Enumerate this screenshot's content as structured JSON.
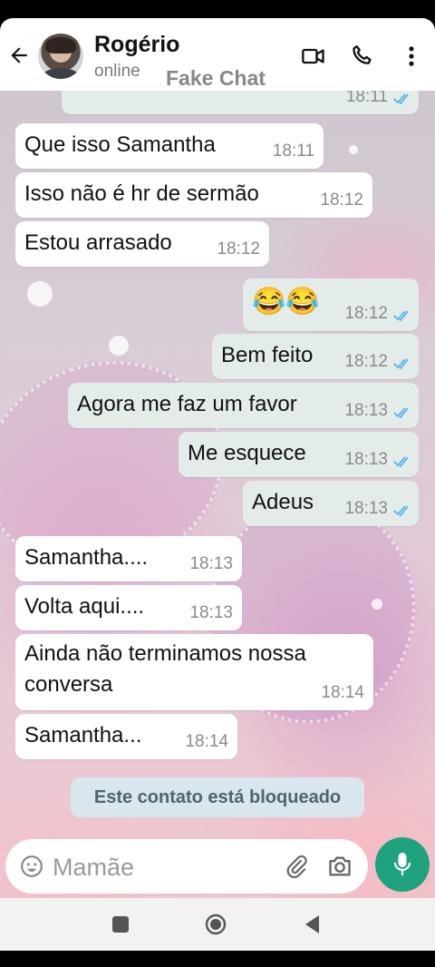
{
  "header": {
    "contact_name": "Rogério",
    "status": "online",
    "watermark": "Fake Chat"
  },
  "messages": [
    {
      "dir": "out",
      "text": "",
      "time": "18:11",
      "read": true
    },
    {
      "dir": "in",
      "text": "Que isso Samantha",
      "time": "18:11"
    },
    {
      "dir": "in",
      "text": "Isso não é hr de sermão",
      "time": "18:12"
    },
    {
      "dir": "in",
      "text": "Estou arrasado",
      "time": "18:12"
    },
    {
      "dir": "out",
      "text": "😂😂",
      "time": "18:12",
      "read": true
    },
    {
      "dir": "out",
      "text": "Bem feito",
      "time": "18:12",
      "read": true
    },
    {
      "dir": "out",
      "text": "Agora me faz um favor",
      "time": "18:13",
      "read": true
    },
    {
      "dir": "out",
      "text": "Me esquece",
      "time": "18:13",
      "read": true
    },
    {
      "dir": "out",
      "text": "Adeus",
      "time": "18:13",
      "read": true
    },
    {
      "dir": "in",
      "text": "Samantha....",
      "time": "18:13"
    },
    {
      "dir": "in",
      "text": "Volta aqui....",
      "time": "18:13"
    },
    {
      "dir": "in",
      "text": "Ainda não terminamos nossa conversa",
      "time": "18:14"
    },
    {
      "dir": "in",
      "text": "Samantha...",
      "time": "18:14"
    }
  ],
  "blocked_notice": "Este contato está bloqueado",
  "composer": {
    "placeholder": "Mamãe",
    "value": ""
  },
  "colors": {
    "accent": "#1fa37f",
    "read_tick": "#4fb6ec",
    "outgoing_bubble": "#e4ecea",
    "incoming_bubble": "#ffffff"
  },
  "icons": {
    "back": "arrow-left-icon",
    "video": "video-camera-icon",
    "call": "phone-icon",
    "menu": "more-vertical-icon",
    "emoji": "emoji-icon",
    "attach": "paperclip-icon",
    "camera": "camera-icon",
    "mic": "microphone-icon"
  }
}
